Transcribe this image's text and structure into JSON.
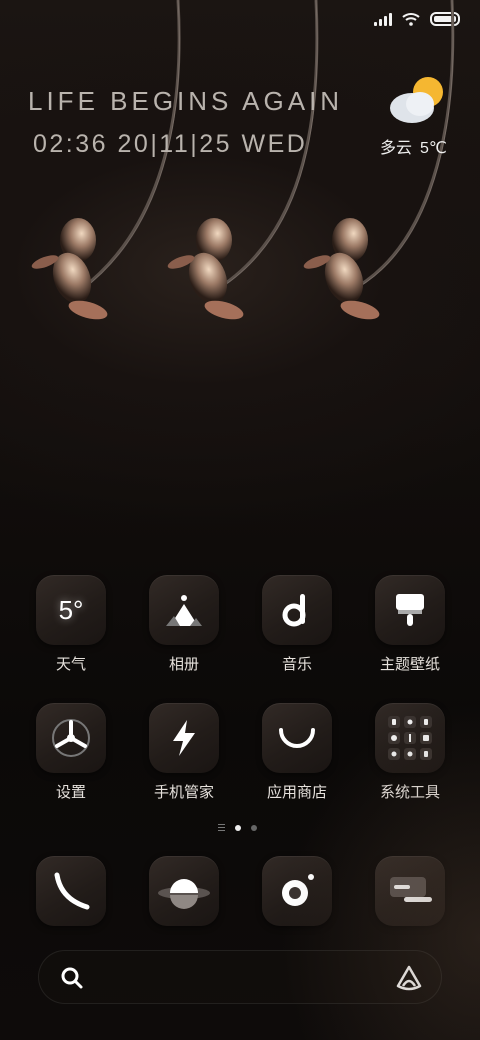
{
  "status_bar": {
    "signal_icon": "signal-icon",
    "wifi_icon": "wifi-icon",
    "battery_icon": "battery-icon",
    "battery_level": 1.0
  },
  "headline": {
    "tagline": "LIFE BEGINS AGAIN",
    "datetime": "02:36 20|11|25 WED"
  },
  "weather": {
    "icon": "partly-cloudy-icon",
    "condition": "多云",
    "temperature": "5℃"
  },
  "apps": [
    {
      "label": "天气",
      "icon": "weather-app-icon",
      "tile_text": "5°"
    },
    {
      "label": "相册",
      "icon": "gallery-icon"
    },
    {
      "label": "音乐",
      "icon": "music-icon"
    },
    {
      "label": "主题壁纸",
      "icon": "theme-brush-icon"
    },
    {
      "label": "设置",
      "icon": "settings-icon"
    },
    {
      "label": "手机管家",
      "icon": "security-lightning-icon"
    },
    {
      "label": "应用商店",
      "icon": "app-store-icon"
    },
    {
      "label": "系统工具",
      "icon": "system-tools-icon"
    }
  ],
  "pager": {
    "pages": 2,
    "active_index": 0
  },
  "dock": [
    {
      "icon": "phone-icon"
    },
    {
      "icon": "browser-planet-icon"
    },
    {
      "icon": "camera-icon"
    },
    {
      "icon": "messages-icon"
    }
  ],
  "search_bar": {
    "search_icon": "search-icon",
    "assistant_icon": "assistant-icon"
  },
  "colors": {
    "text_dim": "#b9b3ad",
    "tile_bg": "#2a2320",
    "sun": "#f5b731"
  }
}
